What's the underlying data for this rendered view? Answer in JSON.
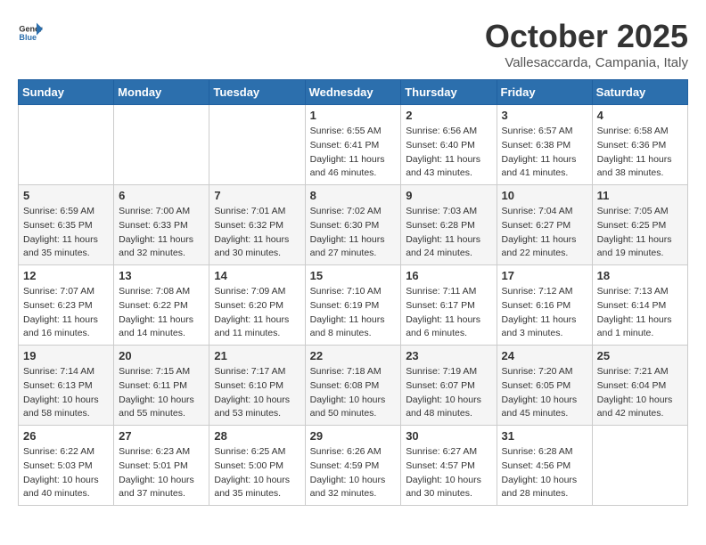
{
  "logo": {
    "general": "General",
    "blue": "Blue"
  },
  "header": {
    "month": "October 2025",
    "location": "Vallesaccarda, Campania, Italy"
  },
  "days_of_week": [
    "Sunday",
    "Monday",
    "Tuesday",
    "Wednesday",
    "Thursday",
    "Friday",
    "Saturday"
  ],
  "weeks": [
    {
      "days": [
        {
          "number": "",
          "info": ""
        },
        {
          "number": "",
          "info": ""
        },
        {
          "number": "",
          "info": ""
        },
        {
          "number": "1",
          "info": "Sunrise: 6:55 AM\nSunset: 6:41 PM\nDaylight: 11 hours and 46 minutes."
        },
        {
          "number": "2",
          "info": "Sunrise: 6:56 AM\nSunset: 6:40 PM\nDaylight: 11 hours and 43 minutes."
        },
        {
          "number": "3",
          "info": "Sunrise: 6:57 AM\nSunset: 6:38 PM\nDaylight: 11 hours and 41 minutes."
        },
        {
          "number": "4",
          "info": "Sunrise: 6:58 AM\nSunset: 6:36 PM\nDaylight: 11 hours and 38 minutes."
        }
      ]
    },
    {
      "days": [
        {
          "number": "5",
          "info": "Sunrise: 6:59 AM\nSunset: 6:35 PM\nDaylight: 11 hours and 35 minutes."
        },
        {
          "number": "6",
          "info": "Sunrise: 7:00 AM\nSunset: 6:33 PM\nDaylight: 11 hours and 32 minutes."
        },
        {
          "number": "7",
          "info": "Sunrise: 7:01 AM\nSunset: 6:32 PM\nDaylight: 11 hours and 30 minutes."
        },
        {
          "number": "8",
          "info": "Sunrise: 7:02 AM\nSunset: 6:30 PM\nDaylight: 11 hours and 27 minutes."
        },
        {
          "number": "9",
          "info": "Sunrise: 7:03 AM\nSunset: 6:28 PM\nDaylight: 11 hours and 24 minutes."
        },
        {
          "number": "10",
          "info": "Sunrise: 7:04 AM\nSunset: 6:27 PM\nDaylight: 11 hours and 22 minutes."
        },
        {
          "number": "11",
          "info": "Sunrise: 7:05 AM\nSunset: 6:25 PM\nDaylight: 11 hours and 19 minutes."
        }
      ]
    },
    {
      "days": [
        {
          "number": "12",
          "info": "Sunrise: 7:07 AM\nSunset: 6:23 PM\nDaylight: 11 hours and 16 minutes."
        },
        {
          "number": "13",
          "info": "Sunrise: 7:08 AM\nSunset: 6:22 PM\nDaylight: 11 hours and 14 minutes."
        },
        {
          "number": "14",
          "info": "Sunrise: 7:09 AM\nSunset: 6:20 PM\nDaylight: 11 hours and 11 minutes."
        },
        {
          "number": "15",
          "info": "Sunrise: 7:10 AM\nSunset: 6:19 PM\nDaylight: 11 hours and 8 minutes."
        },
        {
          "number": "16",
          "info": "Sunrise: 7:11 AM\nSunset: 6:17 PM\nDaylight: 11 hours and 6 minutes."
        },
        {
          "number": "17",
          "info": "Sunrise: 7:12 AM\nSunset: 6:16 PM\nDaylight: 11 hours and 3 minutes."
        },
        {
          "number": "18",
          "info": "Sunrise: 7:13 AM\nSunset: 6:14 PM\nDaylight: 11 hours and 1 minute."
        }
      ]
    },
    {
      "days": [
        {
          "number": "19",
          "info": "Sunrise: 7:14 AM\nSunset: 6:13 PM\nDaylight: 10 hours and 58 minutes."
        },
        {
          "number": "20",
          "info": "Sunrise: 7:15 AM\nSunset: 6:11 PM\nDaylight: 10 hours and 55 minutes."
        },
        {
          "number": "21",
          "info": "Sunrise: 7:17 AM\nSunset: 6:10 PM\nDaylight: 10 hours and 53 minutes."
        },
        {
          "number": "22",
          "info": "Sunrise: 7:18 AM\nSunset: 6:08 PM\nDaylight: 10 hours and 50 minutes."
        },
        {
          "number": "23",
          "info": "Sunrise: 7:19 AM\nSunset: 6:07 PM\nDaylight: 10 hours and 48 minutes."
        },
        {
          "number": "24",
          "info": "Sunrise: 7:20 AM\nSunset: 6:05 PM\nDaylight: 10 hours and 45 minutes."
        },
        {
          "number": "25",
          "info": "Sunrise: 7:21 AM\nSunset: 6:04 PM\nDaylight: 10 hours and 42 minutes."
        }
      ]
    },
    {
      "days": [
        {
          "number": "26",
          "info": "Sunrise: 6:22 AM\nSunset: 5:03 PM\nDaylight: 10 hours and 40 minutes."
        },
        {
          "number": "27",
          "info": "Sunrise: 6:23 AM\nSunset: 5:01 PM\nDaylight: 10 hours and 37 minutes."
        },
        {
          "number": "28",
          "info": "Sunrise: 6:25 AM\nSunset: 5:00 PM\nDaylight: 10 hours and 35 minutes."
        },
        {
          "number": "29",
          "info": "Sunrise: 6:26 AM\nSunset: 4:59 PM\nDaylight: 10 hours and 32 minutes."
        },
        {
          "number": "30",
          "info": "Sunrise: 6:27 AM\nSunset: 4:57 PM\nDaylight: 10 hours and 30 minutes."
        },
        {
          "number": "31",
          "info": "Sunrise: 6:28 AM\nSunset: 4:56 PM\nDaylight: 10 hours and 28 minutes."
        },
        {
          "number": "",
          "info": ""
        }
      ]
    }
  ]
}
